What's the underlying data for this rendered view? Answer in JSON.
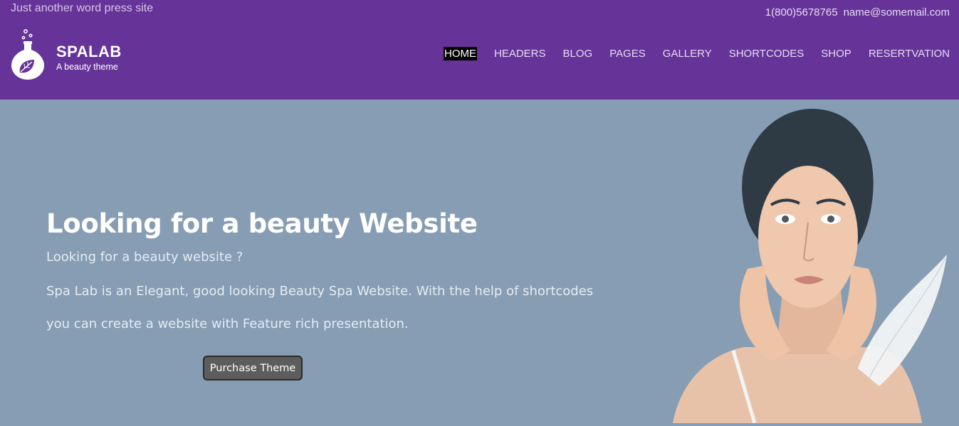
{
  "topbar": {
    "tagline": "Just another word press site",
    "phone": "1(800)5678765",
    "email": "name@somemail.com"
  },
  "brand": {
    "name": "SPALAB",
    "subtitle": "A beauty theme",
    "icon": "flask-leaf-icon"
  },
  "nav": {
    "items": [
      {
        "label": "HOME",
        "active": true
      },
      {
        "label": "HEADERS"
      },
      {
        "label": "BLOG"
      },
      {
        "label": "PAGES"
      },
      {
        "label": "GALLERY"
      },
      {
        "label": "SHORTCODES"
      },
      {
        "label": "SHOP"
      },
      {
        "label": "RESERTVATION"
      }
    ]
  },
  "hero": {
    "title": "Looking for a beauty Website",
    "subtitle": "Looking for a beauty website ?",
    "body": "Spa Lab is an Elegant, good looking Beauty Spa Website. With the help of shortcodes you can create a website with Feature rich presentation.",
    "cta_label": "Purchase Theme",
    "image": "woman-with-feather-image"
  },
  "colors": {
    "header_bg": "#663399",
    "hero_bg": "#869db3",
    "cta_bg": "#5d5d5d"
  }
}
